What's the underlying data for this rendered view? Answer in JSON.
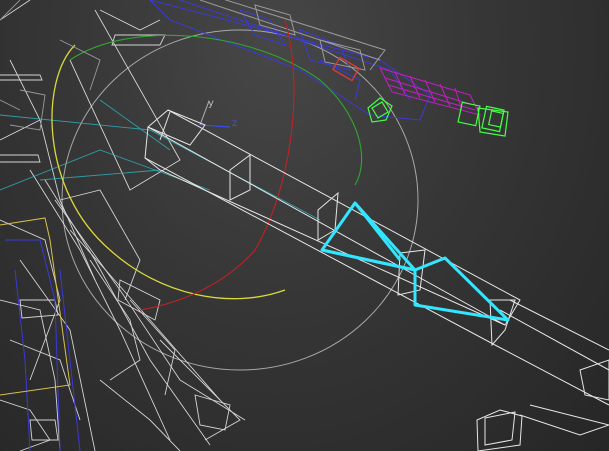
{
  "viewport": {
    "background": "#333333"
  },
  "gizmo": {
    "axis_y_label": "y",
    "axis_z_label": "z",
    "colors": {
      "x_ring": "#c02222",
      "y_ring": "#2fa82f",
      "z_ring": "#d9d93a",
      "screen_ring": "#a8a8a8",
      "axis_y": "#b8b8b8",
      "axis_z": "#3a50ff"
    }
  },
  "colors": {
    "wireframe": "#e6e6e6",
    "wireframe_dim": "#9a9a9a",
    "bone_selected": "#33e6ff",
    "helper_blue": "#3a3ad8",
    "helper_magenta": "#c21fc2",
    "helper_green": "#44ff44",
    "helper_red": "#d23c3c",
    "cyan_dim": "#2fb7c4",
    "gold": "#d8c24a"
  }
}
